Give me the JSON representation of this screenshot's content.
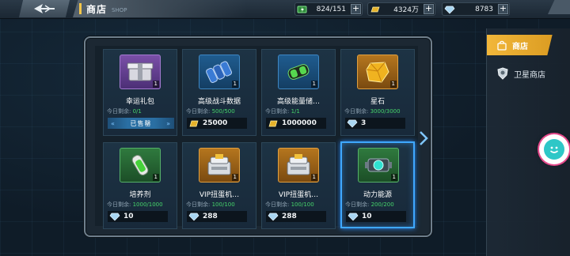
{
  "header": {
    "title": "商店",
    "subtitle": "SHOP",
    "resources": [
      {
        "icon": "energy-icon",
        "value": "824/151"
      },
      {
        "icon": "gold-bar-icon",
        "value": "4324万"
      },
      {
        "icon": "diamond-icon",
        "value": "8783"
      }
    ]
  },
  "shop": {
    "limit_label": "今日剩余:",
    "items": [
      {
        "name": "幸运礼包",
        "limit": "0/1",
        "count": "1",
        "icon": "gift-box-icon",
        "quality": "purple",
        "status": "已售罄",
        "price": "",
        "currency": ""
      },
      {
        "name": "高级战斗数据",
        "limit": "500/500",
        "count": "1",
        "icon": "battery-pack-icon",
        "quality": "blue",
        "price": "25000",
        "currency": "gold-bar-icon"
      },
      {
        "name": "高级能量储…",
        "limit": "1/1",
        "count": "1",
        "icon": "energy-cell-icon",
        "quality": "blue",
        "price": "1000000",
        "currency": "gold-bar-icon"
      },
      {
        "name": "星石",
        "limit": "3000/3000",
        "count": "1",
        "icon": "star-stone-icon",
        "quality": "orange",
        "price": "3",
        "currency": "diamond-icon"
      },
      {
        "name": "培养剂",
        "limit": "1000/1000",
        "count": "1",
        "icon": "culture-vial-icon",
        "quality": "green",
        "price": "10",
        "currency": "diamond-icon"
      },
      {
        "name": "VIP扭蛋机…",
        "limit": "100/100",
        "count": "1",
        "icon": "vip-capsule-machine-icon",
        "quality": "orange",
        "price": "288",
        "currency": "diamond-icon"
      },
      {
        "name": "VIP扭蛋机…",
        "limit": "100/100",
        "count": "1",
        "icon": "vip-capsule-machine-icon",
        "quality": "orange",
        "price": "288",
        "currency": "diamond-icon"
      },
      {
        "name": "动力能源",
        "limit": "200/200",
        "count": "1",
        "icon": "power-core-icon",
        "quality": "green",
        "price": "10",
        "currency": "diamond-icon"
      }
    ]
  },
  "sidebar": {
    "tabs": [
      {
        "label": "商店",
        "active": true
      },
      {
        "label": "卫星商店",
        "active": false
      }
    ]
  },
  "colors": {
    "accent_gold": "#f2b73a",
    "limit_green": "#46d46a",
    "selected_blue": "#3fa8ff"
  }
}
